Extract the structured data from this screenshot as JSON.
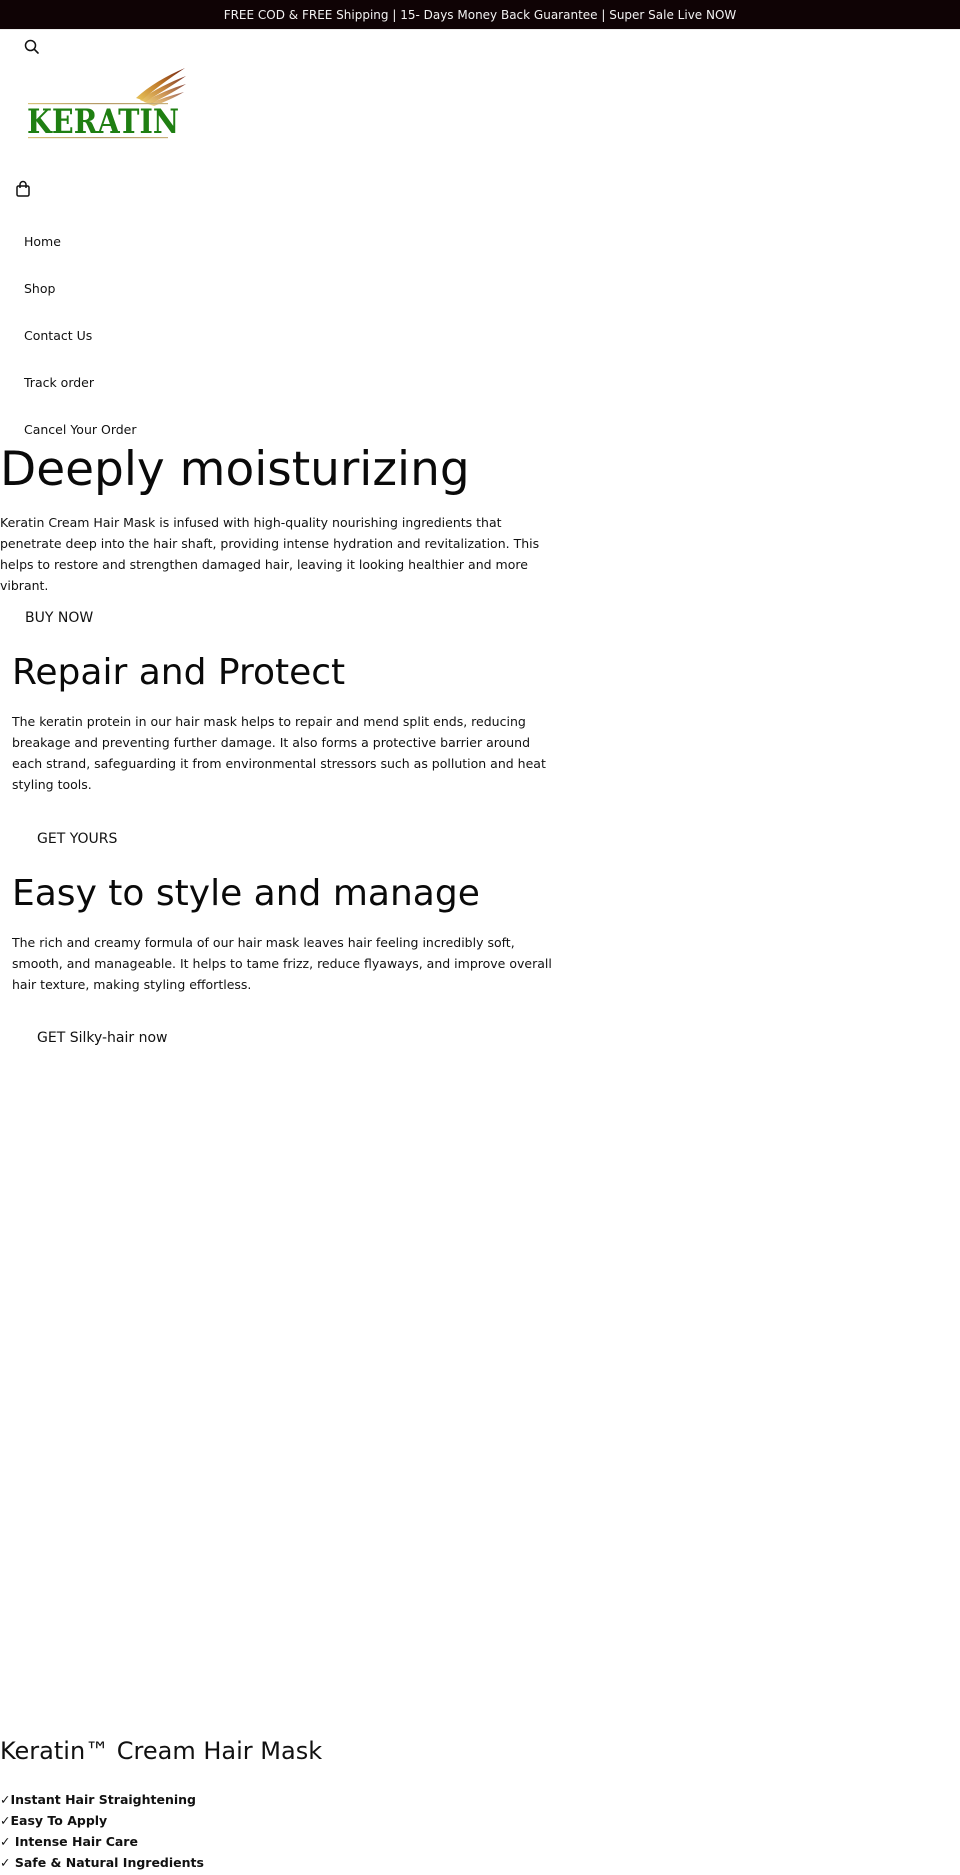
{
  "announcement": "FREE COD & FREE Shipping | 15- Days Money Back Guarantee | Super Sale Live NOW",
  "header": {
    "search_icon": "search-icon",
    "logo_text": "KERATIN",
    "cart_icon": "shopping-bag-icon"
  },
  "nav": {
    "items": [
      {
        "label": "Home"
      },
      {
        "label": "Shop"
      },
      {
        "label": "Contact Us"
      },
      {
        "label": "Track order"
      },
      {
        "label": "Cancel Your Order"
      }
    ]
  },
  "sections": [
    {
      "heading": "Deeply moisturizing",
      "body": "Keratin Cream Hair Mask is infused with high-quality nourishing ingredients that penetrate deep into the hair shaft, providing intense hydration and revitalization. This helps to restore and strengthen damaged hair, leaving it looking healthier and more vibrant.",
      "cta": "BUY NOW"
    },
    {
      "heading": "Repair and Protect",
      "body": "The keratin protein in our hair mask helps to repair and mend split ends, reducing breakage and preventing further damage. It also forms a protective barrier around each strand, safeguarding it from environmental stressors such as pollution and heat styling tools.",
      "cta": "GET YOURS"
    },
    {
      "heading": "Easy to style and manage",
      "body": "The rich and creamy formula of our hair mask leaves hair feeling incredibly soft, smooth, and manageable. It helps to tame frizz, reduce flyaways, and improve overall hair texture, making styling effortless.",
      "cta": "GET Silky-hair now"
    }
  ],
  "product": {
    "title": "Keratin™ Cream Hair Mask",
    "features": [
      "✓Instant Hair Straightening",
      "✓Easy To Apply",
      "✓ Intense Hair Care",
      "✓ Safe & Natural Ingredients"
    ]
  },
  "colors": {
    "announcement_bg": "#0f0305",
    "logo_green": "#1f7f12",
    "logo_gold": "#c9a23c",
    "logo_brown": "#7a2a12"
  }
}
